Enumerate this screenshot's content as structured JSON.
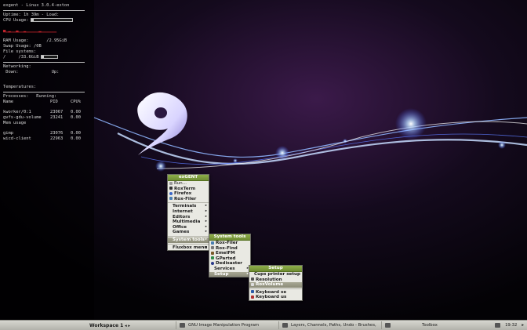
{
  "conky": {
    "title": "exgent - Linux 3.0.4-exton",
    "uptime_label": "Uptime:",
    "uptime_value": "1h 39m",
    "load_label": "Load:",
    "cpu_label": "CPU Usage:",
    "cpu_usage_fraction": 0.05,
    "ram_label": "RAM Usage:",
    "ram_value": "/2.95GiB",
    "ram_usage_fraction": 0.3,
    "swap_label": "Swap Usage:",
    "swap_value": "/0B",
    "file_label": "File systems:",
    "file_prefix": "/",
    "file_value": "/33.6GiB",
    "file_usage_fraction": 0.15,
    "net_label": "Networking:",
    "down_label": "Down:",
    "up_label": "Up:",
    "temp_label": "Temperatures:",
    "proc_label": "Processes:",
    "running_label": "Running:",
    "col_name": "Name",
    "col_pid": "PID",
    "col_cpu": "CPU%",
    "cpu_procs": [
      {
        "name": "kworker/0:1",
        "pid": "23067",
        "cpu": "0.00"
      },
      {
        "name": "gvfs-gdu-volume",
        "pid": "23241",
        "cpu": "0.00"
      }
    ],
    "mem_label": "Mem usage",
    "mem_procs": [
      {
        "name": "gimp",
        "pid": "23076",
        "cpu": "0.00"
      },
      {
        "name": "wicd-client",
        "pid": "22963",
        "cpu": "0.00"
      }
    ]
  },
  "main_menu": {
    "title": "exGENT",
    "run": "Run...",
    "roxterm": "RoxTerm",
    "firefox": "Firefox",
    "roxfiler": "Rox-Filer",
    "terminals": "Terminals",
    "internet": "Internet",
    "editors": "Editors",
    "multimedia": "Multimedia",
    "office": "Office",
    "games": "Games",
    "system_tools": "System tools",
    "fluxbox_menu": "Fluxbox menu"
  },
  "system_menu": {
    "title": "System tools",
    "roxfiler": "Rox-Filer",
    "roxfind": "Rox-Find",
    "emelfm": "EmelFM",
    "gparted": "GParted",
    "dedisaster": "Dedisaster",
    "services": "Services",
    "setup": "Setup"
  },
  "setup_menu": {
    "title": "Setup",
    "cups": "Cups printer setup",
    "resolution": "Resolution",
    "roxvolume": "RoxVolume",
    "keyboard_se": "Keyboard se",
    "keyboard_us": "Keyboard us"
  },
  "taskbar": {
    "workspace": "Workspace 1",
    "tasks": [
      "GNU Image Manipulation Program",
      "Layers, Channels, Paths, Undo - Brushes,",
      "Toolbox"
    ],
    "clock": "19:32"
  },
  "colors": {
    "menu_title": "#7a9a3a",
    "menu_bg": "#e9e9e3",
    "selection": "#9b9b86",
    "conky_blue": "#4a4ad0",
    "conky_red": "#c0232b"
  }
}
